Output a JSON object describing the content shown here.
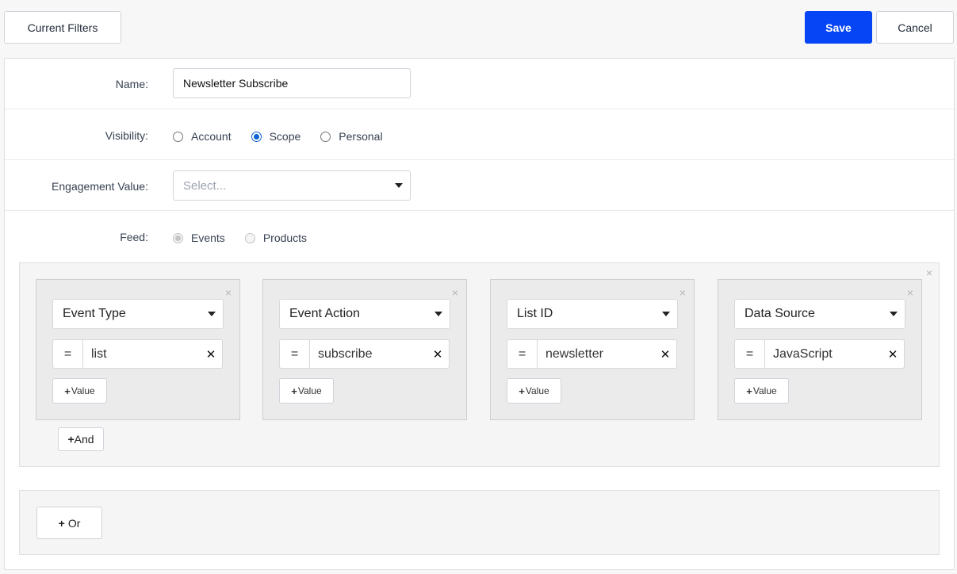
{
  "toolbar": {
    "current_filters_label": "Current Filters",
    "save_label": "Save",
    "cancel_label": "Cancel"
  },
  "form": {
    "name": {
      "label": "Name:",
      "value": "Newsletter Subscribe"
    },
    "visibility": {
      "label": "Visibility:",
      "options": [
        "Account",
        "Scope",
        "Personal"
      ],
      "selected": "Scope"
    },
    "engagement_value": {
      "label": "Engagement Value:",
      "placeholder": "Select..."
    },
    "feed": {
      "label": "Feed:",
      "options": [
        "Events",
        "Products"
      ],
      "selected": "Events"
    }
  },
  "conditions": [
    {
      "field": "Event Type",
      "operator": "=",
      "value": "list",
      "add_value_label": "Value"
    },
    {
      "field": "Event Action",
      "operator": "=",
      "value": "subscribe",
      "add_value_label": "Value"
    },
    {
      "field": "List ID",
      "operator": "=",
      "value": "newsletter",
      "add_value_label": "Value"
    },
    {
      "field": "Data Source",
      "operator": "=",
      "value": "JavaScript",
      "add_value_label": "Value"
    }
  ],
  "group": {
    "and_label": "And",
    "or_label": "Or",
    "close_glyph": "×"
  },
  "colors": {
    "primary": "#0645f5",
    "radio_checked": "#0b63d6"
  }
}
